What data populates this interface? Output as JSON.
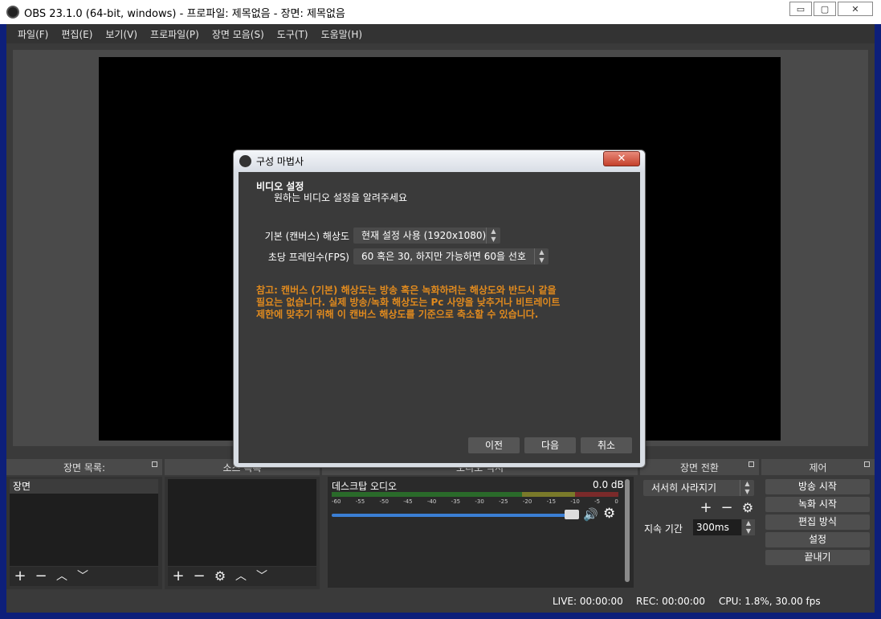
{
  "window": {
    "title": "OBS 23.1.0 (64-bit, windows) - 프로파일: 제목없음 - 장면: 제목없음",
    "minimize": "▭",
    "maximize": "▢",
    "close": "✕"
  },
  "menu": [
    "파일(F)",
    "편집(E)",
    "보기(V)",
    "프로파일(P)",
    "장면 모음(S)",
    "도구(T)",
    "도움말(H)"
  ],
  "docks": {
    "scenes": {
      "title": "장면 목록:",
      "items": [
        "장면"
      ]
    },
    "sources": {
      "title": "소스 목록"
    },
    "mixer": {
      "title": "오디오 믹서",
      "channel": "데스크탑 오디오",
      "db": "0.0 dB",
      "ticks": [
        "-60",
        "-55",
        "-50",
        "-45",
        "-40",
        "-35",
        "-30",
        "-25",
        "-20",
        "-15",
        "-10",
        "-5",
        "0"
      ]
    },
    "transitions": {
      "title": "장면 전환",
      "selected": "서서히 사라지기",
      "duration_label": "지속 기간",
      "duration": "300ms"
    },
    "controls": {
      "title": "제어",
      "buttons": [
        "방송 시작",
        "녹화 시작",
        "편집 방식",
        "설정",
        "끝내기"
      ]
    }
  },
  "status": {
    "live": "LIVE: 00:00:00",
    "rec": "REC: 00:00:00",
    "cpu": "CPU: 1.8%, 30.00 fps"
  },
  "dialog": {
    "title": "구성 마법사",
    "heading": "비디오 설정",
    "subheading": "원하는 비디오 설정을 알려주세요",
    "resolution_label": "기본 (캔버스) 해상도",
    "resolution_value": "현재 설정 사용 (1920x1080)",
    "fps_label": "초당 프레임수(FPS)",
    "fps_value": "60 혹은 30, 하지만 가능하면 60을 선호",
    "note_line1": "참고: 캔버스 (기본) 해상도는 방송 혹은 녹화하려는 해상도와 반드시 같을",
    "note_line2": "필요는 없습니다. 실제 방송/녹화 해상도는 Pc 사양을 낮추거나 비트레이트",
    "note_line3": "제한에 맞추기 위해 이 캔버스 해상도를 기준으로 축소할 수 있습니다.",
    "prev": "이전",
    "next": "다음",
    "cancel": "취소",
    "close": "✕"
  },
  "colors": {
    "note": "#e08a1e",
    "accent": "#3b7fd4",
    "background": "#3a3a3a"
  }
}
